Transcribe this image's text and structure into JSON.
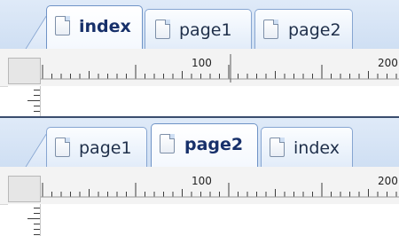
{
  "top": {
    "tabs": [
      {
        "label": "index",
        "active": true
      },
      {
        "label": "page1",
        "active": false
      },
      {
        "label": "page2",
        "active": false
      }
    ],
    "ruler": {
      "major_labels": [
        "100",
        "200"
      ]
    }
  },
  "bottom": {
    "tabs": [
      {
        "label": "page1",
        "active": false
      },
      {
        "label": "page2",
        "active": true
      },
      {
        "label": "index",
        "active": false
      }
    ],
    "ruler": {
      "major_labels": [
        "100",
        "200"
      ]
    }
  },
  "colors": {
    "tabstrip": "#cfdff3",
    "tab_border": "#86a5d1",
    "active_text": "#17306a"
  },
  "icons": {
    "tab": "document-icon"
  }
}
